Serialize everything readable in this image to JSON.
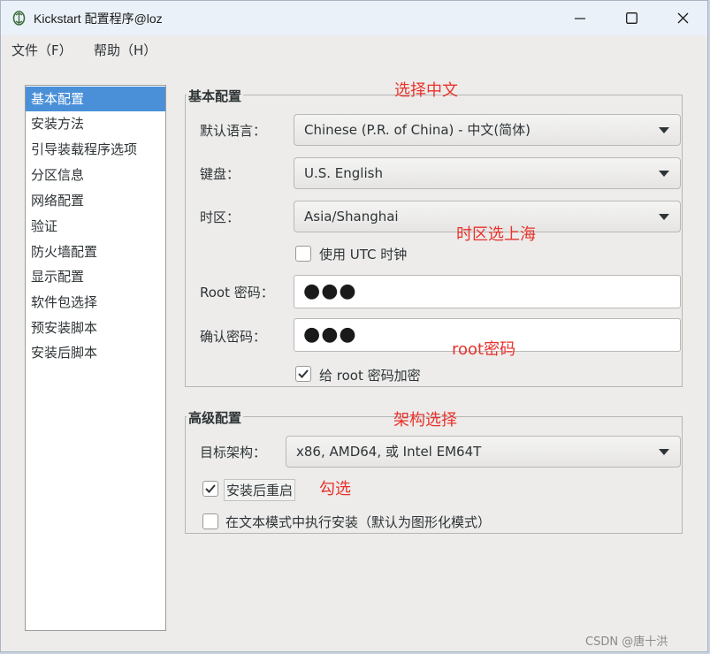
{
  "window": {
    "title": "Kickstart 配置程序@loz",
    "icon": "kickstart-app-icon"
  },
  "menu": {
    "file": "文件（F）",
    "help": "帮助（H）"
  },
  "nav": {
    "items": [
      {
        "label": "基本配置",
        "selected": true
      },
      {
        "label": "安装方法"
      },
      {
        "label": "引导装载程序选项"
      },
      {
        "label": "分区信息"
      },
      {
        "label": "网络配置"
      },
      {
        "label": "验证"
      },
      {
        "label": "防火墙配置"
      },
      {
        "label": "显示配置"
      },
      {
        "label": "软件包选择"
      },
      {
        "label": "预安装脚本"
      },
      {
        "label": "安装后脚本"
      }
    ]
  },
  "basic": {
    "title": "基本配置",
    "language_label": "默认语言：",
    "language_value": "Chinese (P.R. of China) - 中文(简体)",
    "keyboard_label": "键盘：",
    "keyboard_value": "U.S. English",
    "timezone_label": "时区：",
    "timezone_value": "Asia/Shanghai",
    "utc_label": "使用 UTC 时钟",
    "utc_checked": false,
    "root_pw_label": "Root 密码：",
    "root_pw_value": "●●●",
    "confirm_pw_label": "确认密码：",
    "confirm_pw_value": "●●●",
    "encrypt_label": "给 root 密码加密",
    "encrypt_checked": true
  },
  "advanced": {
    "title": "高级配置",
    "arch_label": "目标架构：",
    "arch_value": "x86, AMD64, 或 Intel EM64T",
    "reboot_label": "安装后重启",
    "reboot_checked": true,
    "textmode_label": "在文本模式中执行安装（默认为图形化模式）",
    "textmode_checked": false
  },
  "annotations": {
    "choose_chinese": "选择中文",
    "timezone_shanghai": "时区选上海",
    "root_password": "root密码",
    "arch_choice": "架构选择",
    "check_it": "勾选"
  },
  "watermark": "CSDN @唐十洪",
  "colors": {
    "selection": "#4a90d9",
    "annotation": "#e8322b",
    "titlebar": "#eaf1f8"
  }
}
